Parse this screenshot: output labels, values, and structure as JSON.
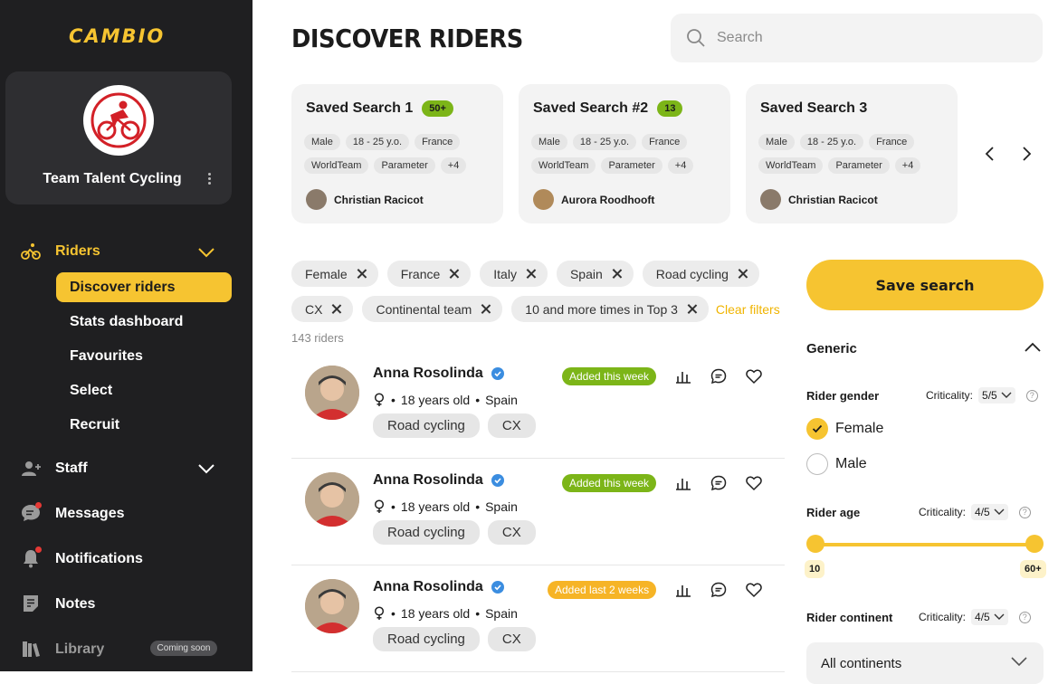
{
  "brand": {
    "logo": "CAMBIO",
    "accent": "#f6c431",
    "sidebar_bg": "#1f1f21"
  },
  "team": {
    "name": "Team Talent Cycling"
  },
  "nav": {
    "riders": "Riders",
    "sub": [
      "Discover riders",
      "Stats dashboard",
      "Favourites",
      "Select",
      "Recruit"
    ],
    "staff": "Staff",
    "messages": "Messages",
    "notifications": "Notifications",
    "notes": "Notes",
    "library": "Library",
    "coming_soon": "Coming soon"
  },
  "page": {
    "title": "DISCOVER RIDERS",
    "search_placeholder": "Search"
  },
  "saved_searches": [
    {
      "name": "Saved Search 1",
      "badge": "50+",
      "chips": [
        "Male",
        "18 - 25 y.o.",
        "France",
        "WorldTeam",
        "Parameter",
        "+4"
      ],
      "owner": "Christian Racicot"
    },
    {
      "name": "Saved Search #2",
      "badge": "13",
      "chips": [
        "Male",
        "18 - 25 y.o.",
        "France",
        "WorldTeam",
        "Parameter",
        "+4"
      ],
      "owner": "Aurora Roodhooft"
    },
    {
      "name": "Saved Search 3",
      "badge": "",
      "chips": [
        "Male",
        "18 - 25 y.o.",
        "France",
        "WorldTeam",
        "Parameter",
        "+4"
      ],
      "owner": "Christian Racicot"
    }
  ],
  "filters": {
    "chips": [
      "Female",
      "France",
      "Italy",
      "Spain",
      "Road cycling",
      "CX",
      "Continental team",
      "10 and more times in Top 3"
    ],
    "clear": "Clear filters",
    "count": "143 riders"
  },
  "riders": [
    {
      "name": "Anna Rosolinda",
      "age": "18 years old",
      "country": "Spain",
      "tags": [
        "Road cycling",
        "CX"
      ],
      "added": "Added this week"
    },
    {
      "name": "Anna Rosolinda",
      "age": "18 years old",
      "country": "Spain",
      "tags": [
        "Road cycling",
        "CX"
      ],
      "added": "Added this week"
    },
    {
      "name": "Anna Rosolinda",
      "age": "18 years old",
      "country": "Spain",
      "tags": [
        "Road cycling",
        "CX"
      ],
      "added": "Added last 2 weeks"
    }
  ],
  "panel": {
    "save": "Save search",
    "section": "Generic",
    "criticality_label": "Criticality:",
    "gender": {
      "label": "Rider gender",
      "criticality": "5/5",
      "options": [
        "Female",
        "Male"
      ],
      "selected": "Female"
    },
    "age": {
      "label": "Rider age",
      "criticality": "4/5",
      "min": "10",
      "max": "60+"
    },
    "continent": {
      "label": "Rider continent",
      "criticality": "4/5",
      "value": "All continents"
    }
  }
}
